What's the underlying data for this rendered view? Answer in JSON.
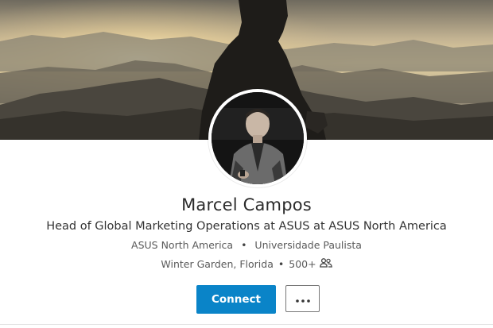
{
  "profile": {
    "name": "Marcel Campos",
    "headline": "Head of Global Marketing Operations at ASUS at ASUS North America",
    "company": "ASUS North America",
    "school": "Universidade Paulista",
    "separator": "•",
    "location": "Winter Garden, Florida",
    "connections": "500+",
    "connections_icon": "people-icon"
  },
  "actions": {
    "connect_label": "Connect",
    "more_icon": "more-horizontal-icon"
  },
  "colors": {
    "accent": "#0a84c8",
    "text_primary": "#2b2b2b",
    "text_secondary": "#5a5a5a"
  }
}
